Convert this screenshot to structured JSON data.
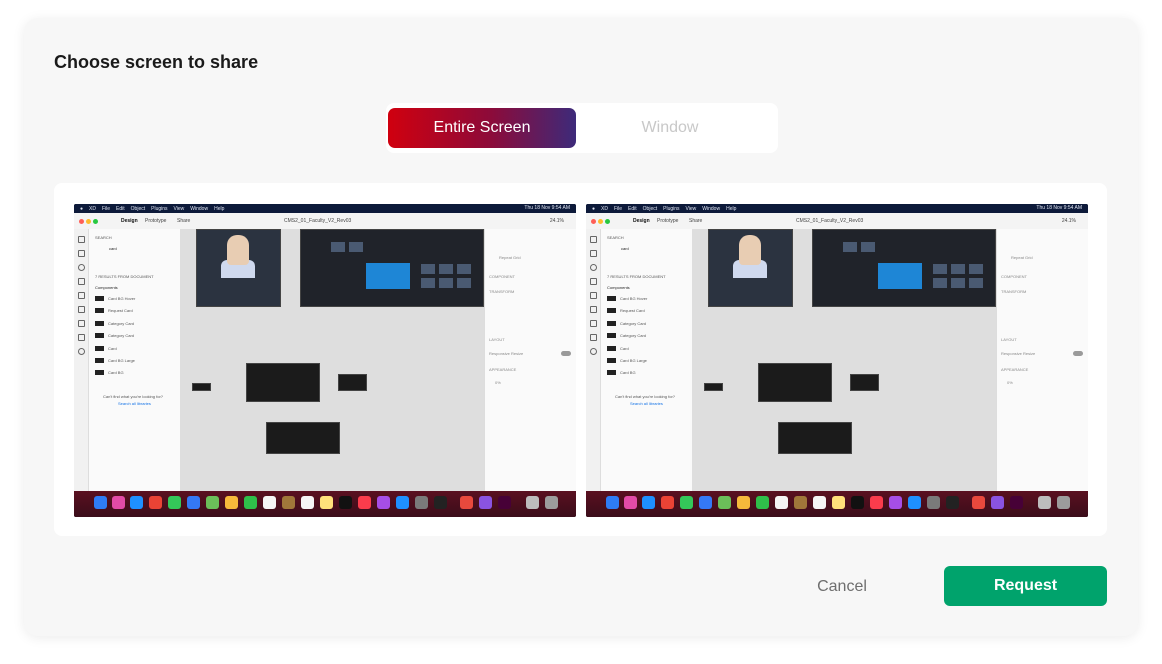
{
  "dialog": {
    "title": "Choose screen to share",
    "tabs": [
      {
        "label": "Entire Screen",
        "selected": true
      },
      {
        "label": "Window",
        "selected": false
      }
    ],
    "cancel_label": "Cancel",
    "request_label": "Request",
    "accent_color": "#00a36c"
  },
  "screens": [
    {
      "menubar": {
        "items": [
          "XD",
          "File",
          "Edit",
          "Object",
          "Plugins",
          "View",
          "Window",
          "Help"
        ],
        "clock": "Thu 18 Nov 9:54 AM"
      },
      "appbar": {
        "tabs": [
          "Design",
          "Prototype",
          "Share"
        ],
        "file_name": "CMS2_01_Faculty_V2_Rev03",
        "zoom": "24.1%"
      },
      "library": {
        "search_label": "SEARCH",
        "search_value": "card",
        "results_label": "7 RESULTS FROM DOCUMENT",
        "section_label": "Components",
        "items": [
          "Card BG Hover",
          "Request Card",
          "Category Card",
          "Category Card",
          "Card",
          "Card BG Large",
          "Card BG"
        ],
        "footer": "Can't find what you're looking for?",
        "footer_link": "Search all libraries"
      },
      "props": {
        "repeat_label": "Repeat Grid",
        "component_label": "COMPONENT",
        "transform_label": "TRANSFORM",
        "layout_label": "LAYOUT",
        "responsive_label": "Responsive Resize",
        "appearance_label": "APPEARANCE",
        "opacity_value": "0%"
      }
    },
    {
      "menubar": {
        "items": [
          "XD",
          "File",
          "Edit",
          "Object",
          "Plugins",
          "View",
          "Window",
          "Help"
        ],
        "clock": "Thu 18 Nov 9:54 AM"
      },
      "appbar": {
        "tabs": [
          "Design",
          "Prototype",
          "Share"
        ],
        "file_name": "CMS2_01_Faculty_V2_Rev03",
        "zoom": "24.1%"
      },
      "library": {
        "search_label": "SEARCH",
        "search_value": "card",
        "results_label": "7 RESULTS FROM DOCUMENT",
        "section_label": "Components",
        "items": [
          "Card BG Hover",
          "Request Card",
          "Category Card",
          "Category Card",
          "Card",
          "Card BG Large",
          "Card BG"
        ],
        "footer": "Can't find what you're looking for?",
        "footer_link": "Search all libraries"
      },
      "props": {
        "repeat_label": "Repeat Grid",
        "component_label": "COMPONENT",
        "transform_label": "TRANSFORM",
        "layout_label": "LAYOUT",
        "responsive_label": "Responsive Resize",
        "appearance_label": "APPEARANCE",
        "opacity_value": "0%"
      }
    }
  ]
}
